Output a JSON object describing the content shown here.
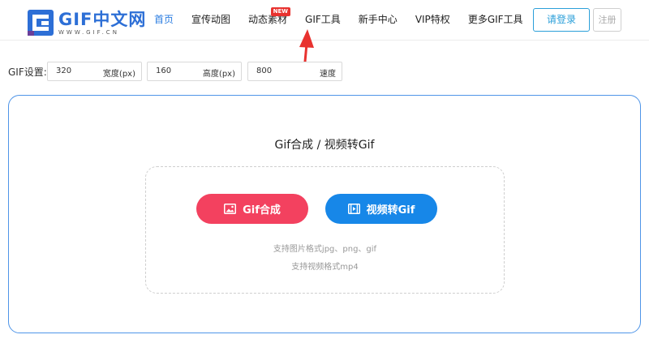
{
  "logo": {
    "title": "GIF中文网",
    "subtitle": "WWW.GIF.CN"
  },
  "nav": {
    "items": [
      {
        "label": "首页",
        "active": true
      },
      {
        "label": "宣传动图"
      },
      {
        "label": "动态素材",
        "badge": "NEW"
      },
      {
        "label": "GIF工具"
      },
      {
        "label": "新手中心"
      },
      {
        "label": "VIP特权"
      },
      {
        "label": "更多GIF工具"
      }
    ]
  },
  "auth": {
    "login_label": "请登录",
    "register_label": "注册"
  },
  "settings": {
    "label": "GIF设置:",
    "width": {
      "value": "320",
      "unit": "宽度(px)"
    },
    "height": {
      "value": "160",
      "unit": "高度(px)"
    },
    "speed": {
      "value": "800",
      "unit": "速度"
    }
  },
  "panel": {
    "title": "Gif合成 / 视频转Gif",
    "gif_button_label": "Gif合成",
    "video_button_label": "视频转Gif",
    "hint_image": "支持图片格式jpg、png、gif",
    "hint_video": "支持视频格式mp4"
  },
  "colors": {
    "brand_blue": "#2b7de1",
    "panel_border": "#4f95e8",
    "gif_button": "#f3415f",
    "video_button": "#1787e8",
    "badge_red": "#e8322f",
    "arrow_red": "#e8322f"
  }
}
